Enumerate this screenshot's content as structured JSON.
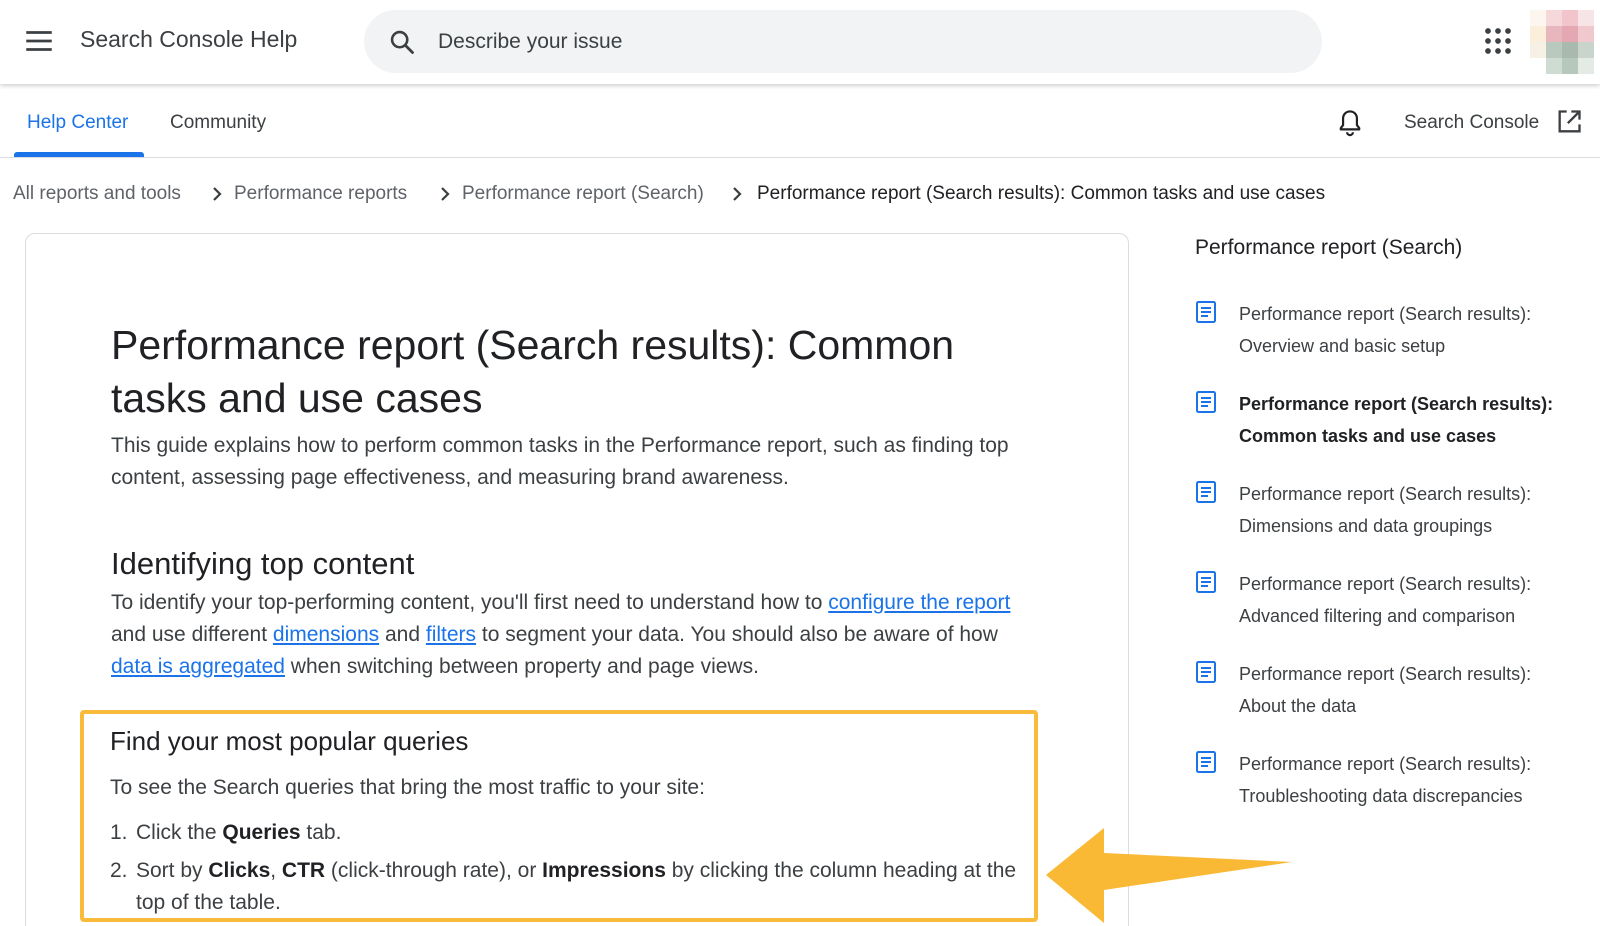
{
  "header": {
    "app_title": "Search Console Help",
    "search_placeholder": "Describe your issue"
  },
  "tabs": [
    {
      "label": "Help Center",
      "active": true
    },
    {
      "label": "Community",
      "active": false
    }
  ],
  "tabbar_right": {
    "link_label": "Search Console"
  },
  "breadcrumb": [
    "All reports and tools",
    "Performance reports",
    "Performance report (Search)",
    "Performance report (Search results): Common tasks and use cases"
  ],
  "article": {
    "title": "Performance report (Search results): Common tasks and use cases",
    "intro": "This guide explains how to perform common tasks in the Performance report, such as finding top content, assessing page effectiveness, and measuring brand awareness.",
    "section_heading": "Identifying top content",
    "para": {
      "t1": "To identify your top-performing content, you'll first need to understand how to ",
      "link1": "configure the report",
      "t2": " and use different ",
      "link2": "dimensions",
      "t3": " and ",
      "link3": "filters",
      "t4": " to segment your data. You should also be aware of how ",
      "link4": "data is aggregated",
      "t5": " when switching between property and page views."
    },
    "callout": {
      "heading": "Find your most popular queries",
      "lead": "To see the Search queries that bring the most traffic to your site:",
      "steps": [
        {
          "num": "1.",
          "a": "Click the ",
          "b1": "Queries",
          "c": " tab."
        },
        {
          "num": "2.",
          "a": "Sort by ",
          "b1": "Clicks",
          "s1": ", ",
          "b2": "CTR",
          "s2": " (click-through rate), or ",
          "b3": "Impressions",
          "c": " by clicking the column heading at the top of the table."
        }
      ]
    }
  },
  "sidebar": {
    "title": "Performance report (Search)",
    "items": [
      {
        "label": "Performance report (Search results): Overview and basic setup",
        "active": false
      },
      {
        "label": "Performance report (Search results): Common tasks and use cases",
        "active": true
      },
      {
        "label": "Performance report (Search results): Dimensions and data groupings",
        "active": false
      },
      {
        "label": "Performance report (Search results): Advanced filtering and comparison",
        "active": false
      },
      {
        "label": "Performance report (Search results): About the data",
        "active": false
      },
      {
        "label": "Performance report (Search results): Troubleshooting data discrepancies",
        "active": false
      }
    ]
  },
  "colors": {
    "accent": "#1a73e8",
    "highlight_border": "#f8bb3b",
    "arrow": "#f9b934"
  },
  "icons": {
    "menu": "hamburger-menu-icon",
    "search": "search-icon",
    "apps": "apps-grid-icon",
    "notifications": "bell-icon",
    "external": "open-in-new-icon",
    "doc": "article-icon",
    "chevron": "chevron-right-icon"
  }
}
